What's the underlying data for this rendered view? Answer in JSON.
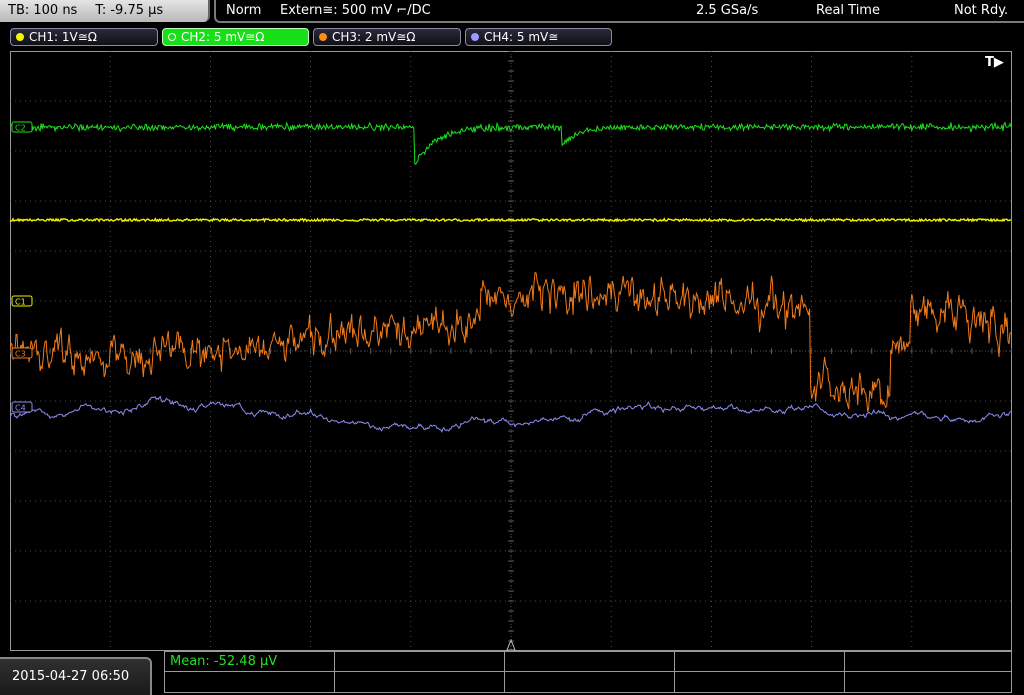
{
  "top": {
    "timebase": "TB: 100 ns",
    "trigger_pos": "T: -9.75 µs",
    "trigger_mode": "Norm",
    "trigger_source": "Extern≅: 500 mV ⌐/DC",
    "sample_rate": "2.5 GSa/s",
    "acq_mode": "Real Time",
    "status": "Not Rdy."
  },
  "channels": [
    {
      "label": "CH1: 1V≅Ω",
      "color": "#f5f500"
    },
    {
      "label": "CH2: 5 mV≅Ω",
      "color": "#22ee22"
    },
    {
      "label": "CH3: 2 mV≅Ω",
      "color": "#ff8c1a"
    },
    {
      "label": "CH4: 5 mV≅",
      "color": "#9b9bff"
    }
  ],
  "markers": {
    "c1": "C1",
    "c2": "C2",
    "c3": "C3",
    "c4": "C4",
    "trigger": "T▶"
  },
  "bottom": {
    "datetime": "2015-04-27 06:50",
    "mean": "Mean: -52.48 µV"
  },
  "colors": {
    "ch1": "#f0f000",
    "ch2": "#1ee01e",
    "ch3": "#f07a1a",
    "ch4": "#8c8cf0",
    "grid": "#5a5a5a"
  }
}
